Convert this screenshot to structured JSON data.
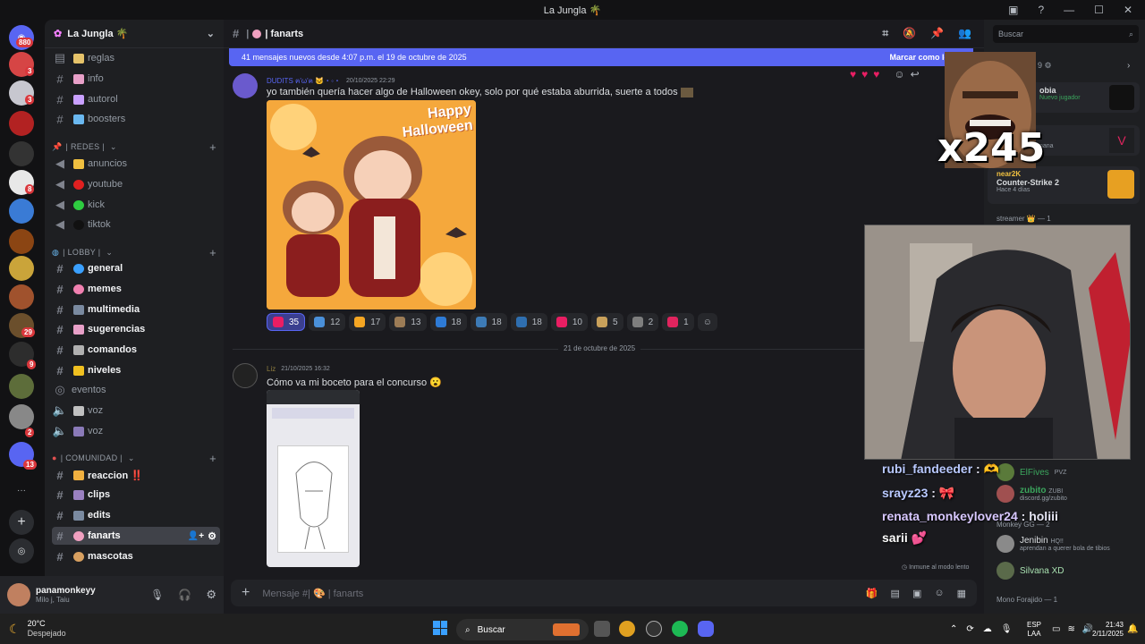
{
  "window": {
    "title": "La Jungla 🌴"
  },
  "server_list": {
    "badges": [
      "880",
      "3",
      "3",
      "8",
      "3",
      "29",
      "9",
      "2",
      "13"
    ]
  },
  "guild": {
    "name": "La Jungla 🌴"
  },
  "channels": {
    "top": [
      {
        "label": "reglas",
        "icon": "📜"
      },
      {
        "label": "info",
        "icon": "📩"
      },
      {
        "label": "autorol",
        "icon": "🎭"
      },
      {
        "label": "boosters",
        "icon": "💎"
      }
    ],
    "redes_header": "| REDES |",
    "redes": [
      {
        "label": "anuncios",
        "icon": "🔔"
      },
      {
        "label": "youtube",
        "icon": "🔴"
      },
      {
        "label": "kick",
        "icon": "🟢"
      },
      {
        "label": "tiktok",
        "icon": "⚫"
      }
    ],
    "lobby_header": "| LOBBY |",
    "lobby": [
      {
        "label": "general",
        "icon": "🌎"
      },
      {
        "label": "memes",
        "icon": "🤪"
      },
      {
        "label": "multimedia",
        "icon": "📼"
      },
      {
        "label": "sugerencias",
        "icon": "📨"
      },
      {
        "label": "comandos",
        "icon": "🤖"
      },
      {
        "label": "niveles",
        "icon": "⚡"
      },
      {
        "label": "eventos",
        "icon": ""
      },
      {
        "label": "voz",
        "icon": "🔊"
      },
      {
        "label": "voz",
        "icon": "🎮"
      }
    ],
    "comunidad_header": "| COMUNIDAD |",
    "comunidad": [
      {
        "label": "reaccion ‼️",
        "icon": "😱"
      },
      {
        "label": "clips",
        "icon": "🎞"
      },
      {
        "label": "edits",
        "icon": "📹"
      },
      {
        "label": "fanarts",
        "icon": "🎨"
      },
      {
        "label": "mascotas",
        "icon": "🐶"
      }
    ]
  },
  "user": {
    "name": "panamonkeyy",
    "status": "Milo j, Taiu"
  },
  "chat": {
    "channel_name": "| fanarts",
    "new_messages": "41 mensajes nuevos desde 4:07 p.m. el 19 de octubre de 2025",
    "mark_read": "Marcar como leído",
    "messages": [
      {
        "author": "DUDITS ฅ'ω'ฅ 🐱・◦・",
        "time": "20/10/2025 22:29",
        "text": "yo también quería hacer algo de Halloween okey, solo por qué estaba aburrida, suerte a todos",
        "author_color": "#5865f2"
      },
      {
        "author": "Liz",
        "time": "21/10/2025 16:32",
        "text": "Cómo va mi boceto para el concurso 😮",
        "author_color": "#8c7b3f"
      }
    ],
    "fanart_caption": "Happy Halloween",
    "reactions": [
      {
        "emoji": "heart",
        "count": "35",
        "color": "#e91e63",
        "me": true
      },
      {
        "emoji": "speech",
        "count": "12",
        "color": "#4a90d9"
      },
      {
        "emoji": "fire",
        "count": "17",
        "color": "#f5a623"
      },
      {
        "emoji": "img",
        "count": "13",
        "color": "#9c7c56"
      },
      {
        "emoji": "A",
        "count": "18",
        "color": "#2e7bd6"
      },
      {
        "emoji": "M",
        "count": "18",
        "color": "#3d7bb6"
      },
      {
        "emoji": "O",
        "count": "18",
        "color": "#2f6fb0"
      },
      {
        "emoji": "heart2",
        "count": "10",
        "color": "#e91e63"
      },
      {
        "emoji": "face",
        "count": "5",
        "color": "#c9a15b"
      },
      {
        "emoji": "pic",
        "count": "2",
        "color": "#7e7e7e"
      },
      {
        "emoji": "heart3",
        "count": "1",
        "color": "#e0245e"
      }
    ],
    "date_divider": "21 de octubre de 2025",
    "composer_placeholder": "Mensaje #| 🎨 | fanarts",
    "slowmode": "Inmune al modo lento"
  },
  "right_panel": {
    "search_placeholder": "Buscar",
    "activity": [
      {
        "title": "obia",
        "sub": "Nuevo jugador"
      },
      {
        "title": "",
        "sub": "nana"
      },
      {
        "title": "near2K",
        "sub": "Counter-Strike 2",
        "sub2": "Hace 4 días"
      }
    ],
    "group_streamer": "streamer 👑 — 1",
    "group_monkey": "Monkey GG — 2",
    "group_mono": "Mono Forajido — 1",
    "members": [
      {
        "name": "ElFives",
        "tag": "PVZ"
      },
      {
        "name": "zubito",
        "tag": "ZUBI",
        "sub": "discord.gg/zubito"
      },
      {
        "name": "Jenibin",
        "tag": "HQ!!",
        "sub": "aprendan a querer bola de tibios"
      },
      {
        "name": "Silvana XD",
        "tag": ""
      }
    ]
  },
  "stream_overlay": {
    "multiplier": "x245",
    "chat": [
      {
        "user": "rubi_fandeeder",
        "text": ":"
      },
      {
        "user": "srayz23",
        "text": ":"
      },
      {
        "user": "renata_monkeylover24",
        "text": ": holiii"
      },
      {
        "user": "sarii",
        "text": ""
      }
    ]
  },
  "taskbar": {
    "weather_temp": "20°C",
    "weather_text": "Despejado",
    "search": "Buscar",
    "lang": "ESP",
    "lang2": "LAA",
    "time": "21:43",
    "date": "2/11/2025"
  }
}
